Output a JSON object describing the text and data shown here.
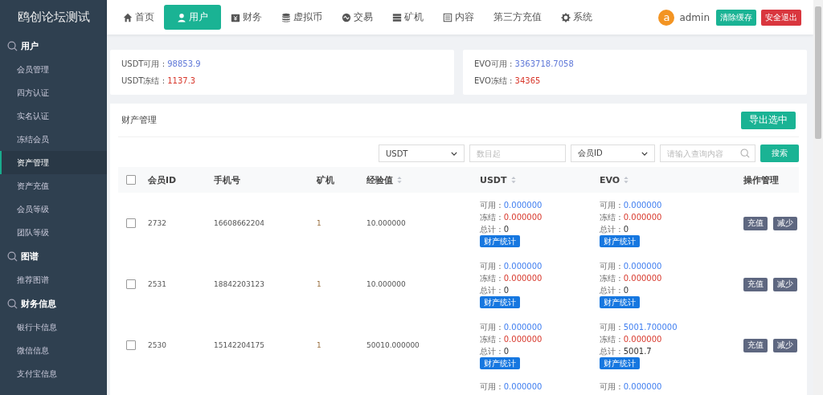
{
  "sidebar": {
    "logo": "鸥创论坛测试",
    "groups": [
      {
        "title": "用户",
        "items": [
          {
            "label": "会员管理",
            "selected": false
          },
          {
            "label": "四方认证",
            "selected": false
          },
          {
            "label": "实名认证",
            "selected": false
          },
          {
            "label": "冻结会员",
            "selected": false
          },
          {
            "label": "资产管理",
            "selected": true
          },
          {
            "label": "资产充值",
            "selected": false
          },
          {
            "label": "会员等级",
            "selected": false
          },
          {
            "label": "团队等级",
            "selected": false
          }
        ]
      },
      {
        "title": "图谱",
        "items": [
          {
            "label": "推荐图谱",
            "selected": false
          }
        ]
      },
      {
        "title": "财务信息",
        "items": [
          {
            "label": "银行卡信息",
            "selected": false
          },
          {
            "label": "微信信息",
            "selected": false
          },
          {
            "label": "支付宝信息",
            "selected": false
          }
        ]
      }
    ]
  },
  "nav": {
    "tabs": [
      {
        "label": "首页",
        "selected": false
      },
      {
        "label": "用户",
        "selected": true
      },
      {
        "label": "财务",
        "selected": false
      },
      {
        "label": "虚拟币",
        "selected": false
      },
      {
        "label": "交易",
        "selected": false
      },
      {
        "label": "矿机",
        "selected": false
      },
      {
        "label": "内容",
        "selected": false
      },
      {
        "label": "第三方充值",
        "selected": false
      },
      {
        "label": "系统",
        "selected": false
      }
    ],
    "avatar": "a",
    "user": "admin",
    "clear_cache": "清除缓存",
    "logout": "安全退出"
  },
  "summary": [
    {
      "available_label": "USDT可用 : ",
      "available": "98853.9",
      "frozen_label": "USDT冻结 : ",
      "frozen": "1137.3"
    },
    {
      "available_label": "EVO可用 : ",
      "available": "3363718.7058",
      "frozen_label": "EVO冻结 : ",
      "frozen": "34365"
    }
  ],
  "panel": {
    "title": "财产管理",
    "export": "导出选中",
    "filters": {
      "coin": "USDT",
      "amount_placeholder": "数目起",
      "field": "会员ID",
      "query_placeholder": "请输入查询内容",
      "search": "搜索"
    },
    "table": {
      "select_all_checked": false,
      "columns": [
        {
          "label": "会员ID",
          "sortable": false
        },
        {
          "label": "手机号",
          "sortable": false
        },
        {
          "label": "矿机",
          "sortable": false
        },
        {
          "label": "经验值",
          "sortable": true
        },
        {
          "label": "USDT",
          "sortable": true
        },
        {
          "label": "EVO",
          "sortable": true
        },
        {
          "label": "操作管理",
          "sortable": false
        }
      ],
      "rows": [
        {
          "checked": false,
          "id": "2732",
          "phone": "16608662204",
          "miner": "1",
          "exp": "10.000000",
          "usdt": {
            "available_label": "可用 : ",
            "available": "0.000000",
            "frozen_label": "冻结 : ",
            "frozen": "0.000000",
            "total_label": "总计 : ",
            "total": "0",
            "stats": "财产统计"
          },
          "evo": {
            "available_label": "可用 : ",
            "available": "0.000000",
            "frozen_label": "冻结 : ",
            "frozen": "0.000000",
            "total_label": "总计 : ",
            "total": "0",
            "stats": "财产统计"
          },
          "actions": [
            "充值",
            "减少"
          ]
        },
        {
          "checked": false,
          "id": "2531",
          "phone": "18842203123",
          "miner": "1",
          "exp": "10.000000",
          "usdt": {
            "available_label": "可用 : ",
            "available": "0.000000",
            "frozen_label": "冻结 : ",
            "frozen": "0.000000",
            "total_label": "总计 : ",
            "total": "0",
            "stats": "财产统计"
          },
          "evo": {
            "available_label": "可用 : ",
            "available": "0.000000",
            "frozen_label": "冻结 : ",
            "frozen": "0.000000",
            "total_label": "总计 : ",
            "total": "0",
            "stats": "财产统计"
          },
          "actions": [
            "充值",
            "减少"
          ]
        },
        {
          "checked": false,
          "id": "2530",
          "phone": "15142204175",
          "miner": "1",
          "exp": "50010.000000",
          "usdt": {
            "available_label": "可用 : ",
            "available": "0.000000",
            "frozen_label": "冻结 : ",
            "frozen": "0.000000",
            "total_label": "总计 : ",
            "total": "0",
            "stats": "财产统计"
          },
          "evo": {
            "available_label": "可用 : ",
            "available": "5001.700000",
            "frozen_label": "冻结 : ",
            "frozen": "0.000000",
            "total_label": "总计 : ",
            "total": "5001.7",
            "stats": "财产统计"
          },
          "actions": [
            "充值",
            "减少"
          ]
        },
        {
          "usdt": {
            "available_label": "可用 : ",
            "available": "0.000000"
          },
          "evo": {
            "available_label": "可用 : ",
            "available": "0.000000"
          }
        }
      ]
    }
  }
}
